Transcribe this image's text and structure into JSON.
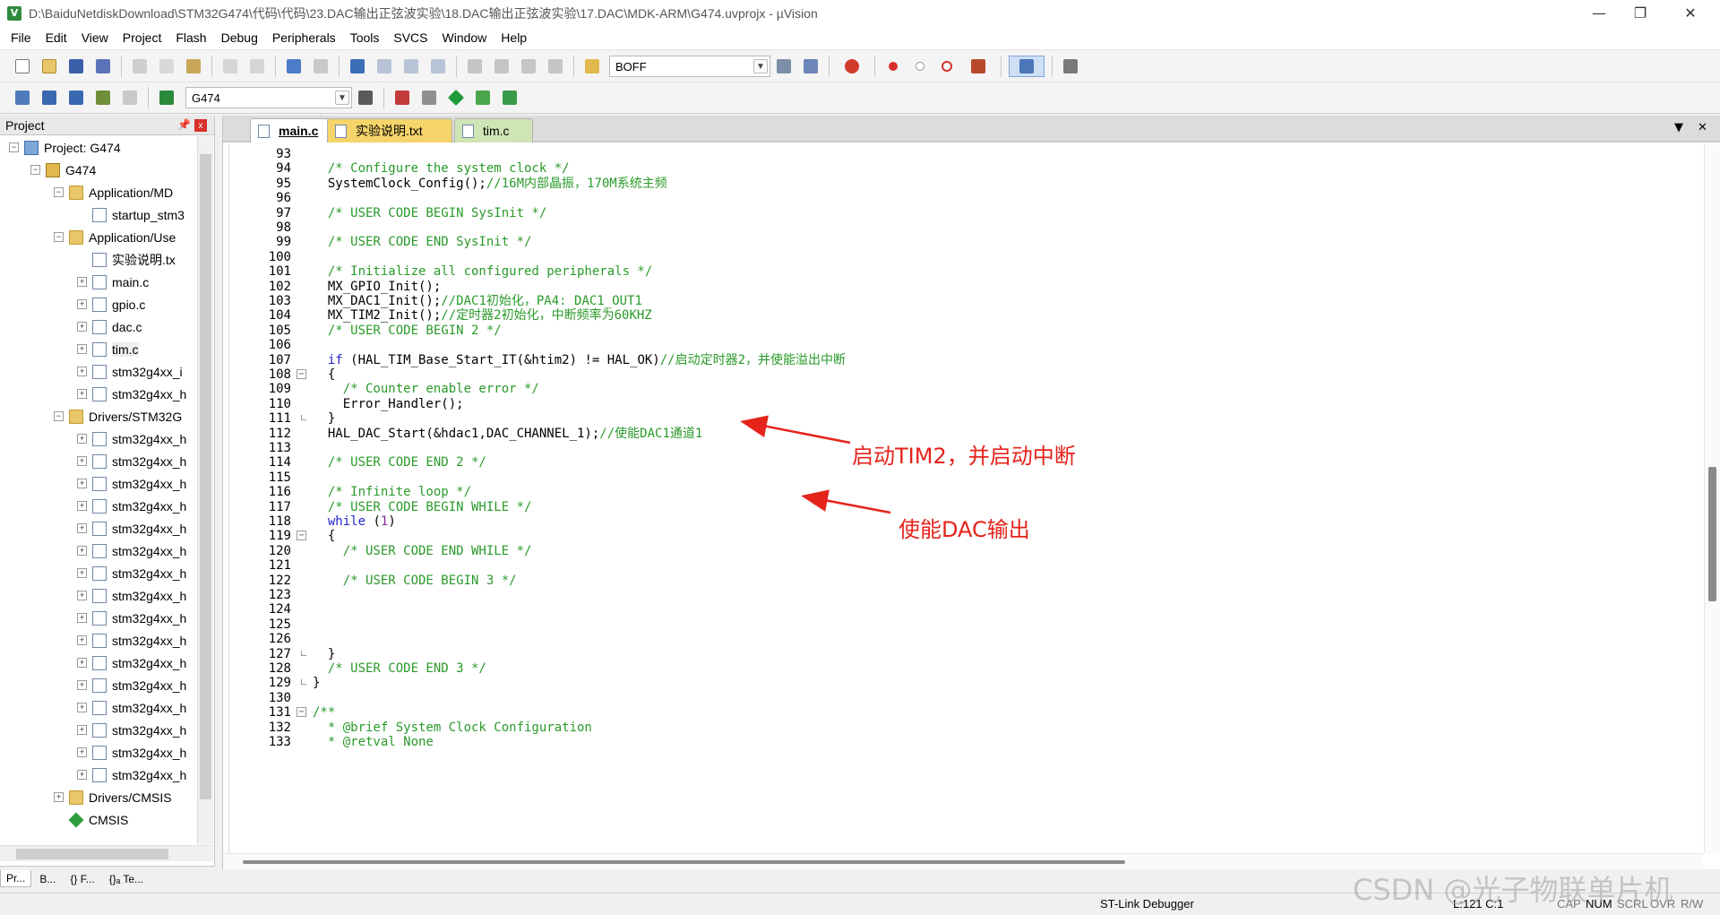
{
  "window": {
    "title": "D:\\BaiduNetdiskDownload\\STM32G474\\代码\\代码\\23.DAC输出正弦波实验\\18.DAC输出正弦波实验\\17.DAC\\MDK-ARM\\G474.uvprojx - µVision",
    "app_icon": "V",
    "minimize": "—",
    "restore": "❐",
    "close": "✕"
  },
  "menu": [
    "File",
    "Edit",
    "View",
    "Project",
    "Flash",
    "Debug",
    "Peripherals",
    "Tools",
    "SVCS",
    "Window",
    "Help"
  ],
  "toolbar1": {
    "find_combo_value": "BOFF"
  },
  "toolbar2": {
    "target_combo_value": "G474"
  },
  "project_panel": {
    "title": "Project",
    "pin": "📌",
    "close": "x",
    "tree": [
      {
        "label": "Project: G474",
        "depth": 0,
        "icon": "proj",
        "exp": "−"
      },
      {
        "label": "G474",
        "depth": 1,
        "icon": "target",
        "exp": "−"
      },
      {
        "label": "Application/MD",
        "depth": 2,
        "icon": "folder",
        "exp": "−"
      },
      {
        "label": "startup_stm3",
        "depth": 3,
        "icon": "file",
        "exp": ""
      },
      {
        "label": "Application/Use",
        "depth": 2,
        "icon": "folder",
        "exp": "−"
      },
      {
        "label": "实验说明.tx",
        "depth": 3,
        "icon": "file",
        "exp": ""
      },
      {
        "label": "main.c",
        "depth": 3,
        "icon": "file",
        "exp": "+"
      },
      {
        "label": "gpio.c",
        "depth": 3,
        "icon": "file",
        "exp": "+"
      },
      {
        "label": "dac.c",
        "depth": 3,
        "icon": "file",
        "exp": "+"
      },
      {
        "label": "tim.c",
        "depth": 3,
        "icon": "file",
        "exp": "+",
        "selected": true
      },
      {
        "label": "stm32g4xx_i",
        "depth": 3,
        "icon": "file",
        "exp": "+"
      },
      {
        "label": "stm32g4xx_h",
        "depth": 3,
        "icon": "file",
        "exp": "+"
      },
      {
        "label": "Drivers/STM32G",
        "depth": 2,
        "icon": "folder",
        "exp": "−"
      },
      {
        "label": "stm32g4xx_h",
        "depth": 3,
        "icon": "file",
        "exp": "+"
      },
      {
        "label": "stm32g4xx_h",
        "depth": 3,
        "icon": "file",
        "exp": "+"
      },
      {
        "label": "stm32g4xx_h",
        "depth": 3,
        "icon": "file",
        "exp": "+"
      },
      {
        "label": "stm32g4xx_h",
        "depth": 3,
        "icon": "file",
        "exp": "+"
      },
      {
        "label": "stm32g4xx_h",
        "depth": 3,
        "icon": "file",
        "exp": "+"
      },
      {
        "label": "stm32g4xx_h",
        "depth": 3,
        "icon": "file",
        "exp": "+"
      },
      {
        "label": "stm32g4xx_h",
        "depth": 3,
        "icon": "file",
        "exp": "+"
      },
      {
        "label": "stm32g4xx_h",
        "depth": 3,
        "icon": "file",
        "exp": "+"
      },
      {
        "label": "stm32g4xx_h",
        "depth": 3,
        "icon": "file",
        "exp": "+"
      },
      {
        "label": "stm32g4xx_h",
        "depth": 3,
        "icon": "file",
        "exp": "+"
      },
      {
        "label": "stm32g4xx_h",
        "depth": 3,
        "icon": "file",
        "exp": "+"
      },
      {
        "label": "stm32g4xx_h",
        "depth": 3,
        "icon": "file",
        "exp": "+"
      },
      {
        "label": "stm32g4xx_h",
        "depth": 3,
        "icon": "file",
        "exp": "+"
      },
      {
        "label": "stm32g4xx_h",
        "depth": 3,
        "icon": "file",
        "exp": "+"
      },
      {
        "label": "stm32g4xx_h",
        "depth": 3,
        "icon": "file",
        "exp": "+"
      },
      {
        "label": "stm32g4xx_h",
        "depth": 3,
        "icon": "file",
        "exp": "+"
      },
      {
        "label": "Drivers/CMSIS",
        "depth": 2,
        "icon": "folder",
        "exp": "+"
      },
      {
        "label": "CMSIS",
        "depth": 2,
        "icon": "cmsis",
        "exp": ""
      }
    ],
    "tabs": [
      "Pr...",
      "B...",
      "{} F...",
      "{}ₐ Te..."
    ]
  },
  "editor": {
    "tabs": [
      "main.c",
      "实验说明.txt",
      "tim.c"
    ],
    "tab_menu": "▼",
    "tab_close": "✕",
    "lines": [
      {
        "n": "93",
        "fold": "",
        "parts": []
      },
      {
        "n": "94",
        "fold": "",
        "parts": [
          [
            "  ",
            "df"
          ],
          [
            "/* Configure the system clock */",
            "cm"
          ]
        ]
      },
      {
        "n": "95",
        "fold": "",
        "parts": [
          [
            "  SystemClock_Config();",
            "df"
          ],
          [
            "//16M内部晶振，170M系统主频",
            "cm"
          ]
        ]
      },
      {
        "n": "96",
        "fold": "",
        "parts": []
      },
      {
        "n": "97",
        "fold": "",
        "parts": [
          [
            "  ",
            "df"
          ],
          [
            "/* USER CODE BEGIN SysInit */",
            "cm"
          ]
        ]
      },
      {
        "n": "98",
        "fold": "",
        "parts": []
      },
      {
        "n": "99",
        "fold": "",
        "parts": [
          [
            "  ",
            "df"
          ],
          [
            "/* USER CODE END SysInit */",
            "cm"
          ]
        ]
      },
      {
        "n": "100",
        "fold": "",
        "parts": []
      },
      {
        "n": "101",
        "fold": "",
        "parts": [
          [
            "  ",
            "df"
          ],
          [
            "/* Initialize all configured peripherals */",
            "cm"
          ]
        ]
      },
      {
        "n": "102",
        "fold": "",
        "parts": [
          [
            "  MX_GPIO_Init();",
            "df"
          ]
        ]
      },
      {
        "n": "103",
        "fold": "",
        "parts": [
          [
            "  MX_DAC1_Init();",
            "df"
          ],
          [
            "//DAC1初始化，PA4: DAC1_OUT1",
            "cm"
          ]
        ]
      },
      {
        "n": "104",
        "fold": "",
        "parts": [
          [
            "  MX_TIM2_Init();",
            "df"
          ],
          [
            "//定时器2初始化，中断频率为60KHZ",
            "cm"
          ]
        ]
      },
      {
        "n": "105",
        "fold": "",
        "parts": [
          [
            "  ",
            "df"
          ],
          [
            "/* USER CODE BEGIN 2 */",
            "cm"
          ]
        ]
      },
      {
        "n": "106",
        "fold": "",
        "parts": []
      },
      {
        "n": "107",
        "fold": "",
        "parts": [
          [
            "  ",
            "df"
          ],
          [
            "if",
            "kw"
          ],
          [
            " (HAL_TIM_Base_Start_IT(&htim2) != HAL_OK)",
            "df"
          ],
          [
            "//启动定时器2，并使能溢出中断",
            "cm"
          ]
        ]
      },
      {
        "n": "108",
        "fold": "−",
        "parts": [
          [
            "  {",
            "df"
          ]
        ]
      },
      {
        "n": "109",
        "fold": "",
        "parts": [
          [
            "    ",
            "df"
          ],
          [
            "/* Counter enable error */",
            "cm"
          ]
        ]
      },
      {
        "n": "110",
        "fold": "",
        "parts": [
          [
            "    Error_Handler();",
            "df"
          ]
        ]
      },
      {
        "n": "111",
        "fold": "end",
        "parts": [
          [
            "  }",
            "df"
          ]
        ]
      },
      {
        "n": "112",
        "fold": "",
        "parts": [
          [
            "  HAL_DAC_Start(&hdac1,DAC_CHANNEL_1);",
            "df"
          ],
          [
            "//使能DAC1通道1",
            "cm"
          ]
        ]
      },
      {
        "n": "113",
        "fold": "",
        "parts": []
      },
      {
        "n": "114",
        "fold": "",
        "parts": [
          [
            "  ",
            "df"
          ],
          [
            "/* USER CODE END 2 */",
            "cm"
          ]
        ]
      },
      {
        "n": "115",
        "fold": "",
        "parts": []
      },
      {
        "n": "116",
        "fold": "",
        "parts": [
          [
            "  ",
            "df"
          ],
          [
            "/* Infinite loop */",
            "cm"
          ]
        ]
      },
      {
        "n": "117",
        "fold": "",
        "parts": [
          [
            "  ",
            "df"
          ],
          [
            "/* USER CODE BEGIN WHILE */",
            "cm"
          ]
        ]
      },
      {
        "n": "118",
        "fold": "",
        "parts": [
          [
            "  ",
            "df"
          ],
          [
            "while",
            "kw"
          ],
          [
            " (",
            "df"
          ],
          [
            "1",
            "nm"
          ],
          [
            ")",
            "df"
          ]
        ]
      },
      {
        "n": "119",
        "fold": "−",
        "parts": [
          [
            "  {",
            "df"
          ]
        ]
      },
      {
        "n": "120",
        "fold": "",
        "parts": [
          [
            "    ",
            "df"
          ],
          [
            "/* USER CODE END WHILE */",
            "cm"
          ]
        ]
      },
      {
        "n": "121",
        "fold": "",
        "parts": []
      },
      {
        "n": "122",
        "fold": "",
        "parts": [
          [
            "    ",
            "df"
          ],
          [
            "/* USER CODE BEGIN 3 */",
            "cm"
          ]
        ]
      },
      {
        "n": "123",
        "fold": "",
        "parts": []
      },
      {
        "n": "124",
        "fold": "",
        "parts": []
      },
      {
        "n": "125",
        "fold": "",
        "parts": []
      },
      {
        "n": "126",
        "fold": "",
        "parts": []
      },
      {
        "n": "127",
        "fold": "end",
        "parts": [
          [
            "  }",
            "df"
          ]
        ]
      },
      {
        "n": "128",
        "fold": "",
        "parts": [
          [
            "  ",
            "df"
          ],
          [
            "/* USER CODE END 3 */",
            "cm"
          ]
        ]
      },
      {
        "n": "129",
        "fold": "end",
        "parts": [
          [
            "}",
            "df"
          ]
        ]
      },
      {
        "n": "130",
        "fold": "",
        "parts": []
      },
      {
        "n": "131",
        "fold": "−",
        "parts": [
          [
            "/**",
            "cm"
          ]
        ]
      },
      {
        "n": "132",
        "fold": "",
        "parts": [
          [
            "  * @brief System Clock Configuration",
            "cm"
          ]
        ]
      },
      {
        "n": "133",
        "fold": "",
        "parts": [
          [
            "  * @retval None",
            "cm"
          ]
        ]
      }
    ],
    "annotations": {
      "tim2": "启动TIM2，并启动中断",
      "dac": "使能DAC输出"
    }
  },
  "status": {
    "debugger": "ST-Link Debugger",
    "position": "L:121 C:1",
    "cap": "CAP",
    "num": "NUM",
    "scrl": "SCRL",
    "ovr": "OVR",
    "rw": "R/W"
  },
  "watermark": "CSDN @光子物联单片机",
  "colors": {
    "comment": "#2a9a2a",
    "keyword": "#1f24c9",
    "annotation": "#e5231b",
    "tab_txt": "#f5d46a",
    "tab_tim": "#cfe5b5"
  }
}
